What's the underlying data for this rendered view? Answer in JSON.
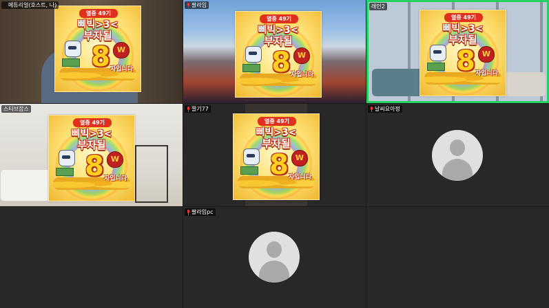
{
  "participants": [
    {
      "name": "메튜리얼(호스트, 나)",
      "muted": false
    },
    {
      "name": "팔라임",
      "muted": true
    },
    {
      "name": "레인2",
      "muted": false,
      "active_speaker": true
    },
    {
      "name": "스티브잡스",
      "muted": false
    },
    {
      "name": "짤기77",
      "muted": true
    },
    {
      "name": "날씨요아정",
      "muted": true
    },
    {
      "name": "팔라임pc",
      "muted": true
    }
  ],
  "poster": {
    "banner": "열중 49기",
    "line1": "삐빅>3<",
    "line2": "부자될",
    "number": "8",
    "suffix": "자입니다",
    "coin_symbol": "W"
  },
  "colors": {
    "active_border": "#23d160",
    "mic_muted": "#ee3333"
  }
}
